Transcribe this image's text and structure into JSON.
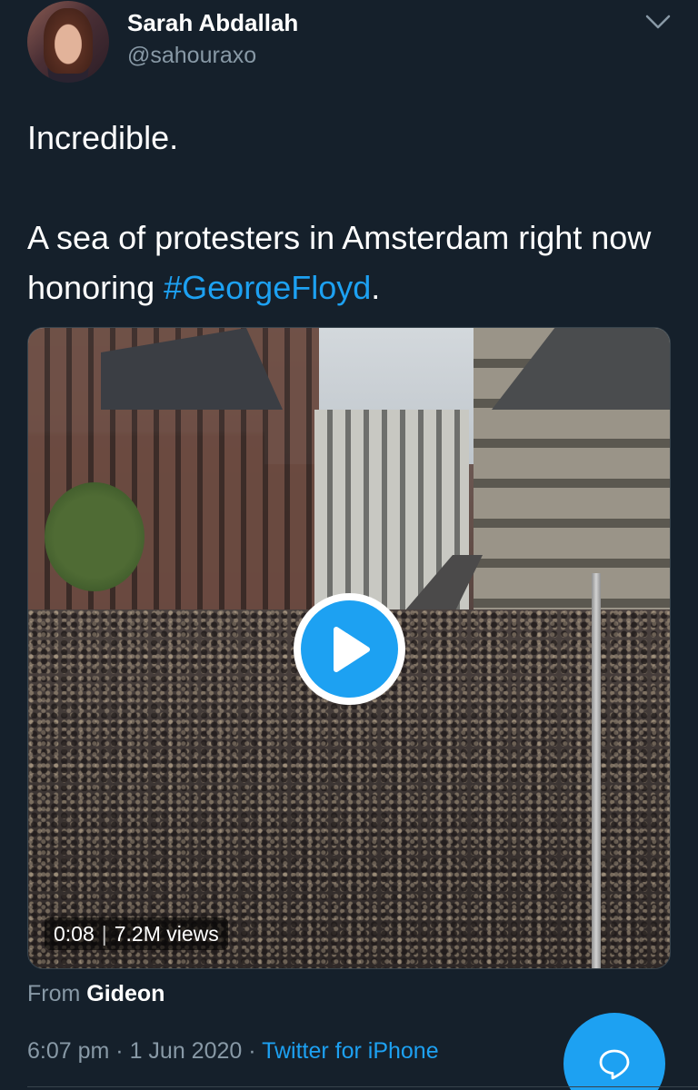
{
  "author": {
    "display_name": "Sarah Abdallah",
    "handle": "@sahouraxo",
    "avatar_icon": "profile-photo"
  },
  "tweet": {
    "line1": "Incredible.",
    "line2_before": "A sea of protesters in Amsterdam right now honoring ",
    "hashtag": "#GeorgeFloyd",
    "line2_after": "."
  },
  "video": {
    "elapsed": "0:08",
    "views": "7.2M views",
    "play_icon": "play-icon"
  },
  "attribution": {
    "from_label": "From",
    "from_name": "Gideon"
  },
  "meta": {
    "time": "6:07 pm",
    "dot1": "·",
    "date": "1 Jun 2020",
    "dot2": "·",
    "source": "Twitter for iPhone"
  },
  "colors": {
    "background": "#15202b",
    "accent": "#1da1f2",
    "secondary_text": "#8899a6"
  }
}
